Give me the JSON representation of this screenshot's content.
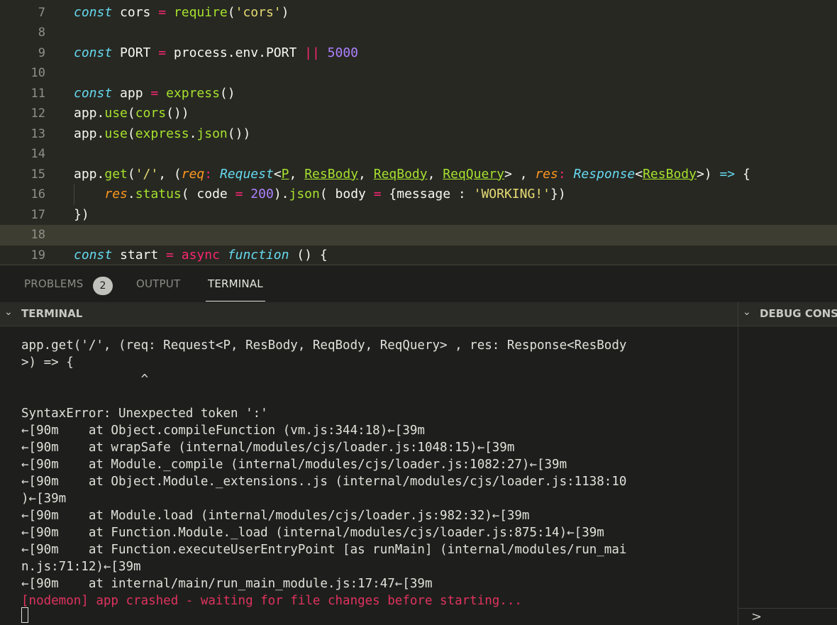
{
  "editor": {
    "lines": [
      {
        "num": "7",
        "tokens": [
          [
            "kw",
            "const"
          ],
          [
            "p",
            " cors "
          ],
          [
            "op",
            "="
          ],
          [
            "p",
            " "
          ],
          [
            "fn",
            "require"
          ],
          [
            "p",
            "("
          ],
          [
            "str",
            "'cors'"
          ],
          [
            "p",
            ")"
          ]
        ]
      },
      {
        "num": "8",
        "tokens": []
      },
      {
        "num": "9",
        "tokens": [
          [
            "kw",
            "const"
          ],
          [
            "p",
            " PORT "
          ],
          [
            "op",
            "="
          ],
          [
            "p",
            " process.env.PORT "
          ],
          [
            "op",
            "||"
          ],
          [
            "p",
            " "
          ],
          [
            "num",
            "5000"
          ]
        ]
      },
      {
        "num": "10",
        "tokens": []
      },
      {
        "num": "11",
        "tokens": [
          [
            "kw",
            "const"
          ],
          [
            "p",
            " app "
          ],
          [
            "op",
            "="
          ],
          [
            "p",
            " "
          ],
          [
            "fn",
            "express"
          ],
          [
            "p",
            "()"
          ]
        ]
      },
      {
        "num": "12",
        "tokens": [
          [
            "p",
            "app."
          ],
          [
            "fn",
            "use"
          ],
          [
            "p",
            "("
          ],
          [
            "fn",
            "cors"
          ],
          [
            "p",
            "())"
          ]
        ]
      },
      {
        "num": "13",
        "tokens": [
          [
            "p",
            "app."
          ],
          [
            "fn",
            "use"
          ],
          [
            "p",
            "("
          ],
          [
            "fn",
            "express"
          ],
          [
            "p",
            "."
          ],
          [
            "fn",
            "json"
          ],
          [
            "p",
            "())"
          ]
        ]
      },
      {
        "num": "14",
        "tokens": []
      },
      {
        "num": "15",
        "tokens": [
          [
            "p",
            "app."
          ],
          [
            "fn",
            "get"
          ],
          [
            "p",
            "("
          ],
          [
            "str",
            "'/'"
          ],
          [
            "p",
            ", ("
          ],
          [
            "param",
            "req"
          ],
          [
            "op",
            ":"
          ],
          [
            "p",
            " "
          ],
          [
            "type",
            "Request"
          ],
          [
            "p",
            "<"
          ],
          [
            "ul",
            "P"
          ],
          [
            "p",
            ", "
          ],
          [
            "ul",
            "ResBody"
          ],
          [
            "p",
            ", "
          ],
          [
            "ul",
            "ReqBody"
          ],
          [
            "p",
            ", "
          ],
          [
            "ul",
            "ReqQuery"
          ],
          [
            "p",
            "> , "
          ],
          [
            "param",
            "res"
          ],
          [
            "op",
            ":"
          ],
          [
            "p",
            " "
          ],
          [
            "type",
            "Response"
          ],
          [
            "p",
            "<"
          ],
          [
            "ul",
            "ResBody"
          ],
          [
            "p",
            ">) "
          ],
          [
            "kw",
            "=>"
          ],
          [
            "p",
            " {"
          ]
        ]
      },
      {
        "num": "16",
        "tokens": [
          [
            "p",
            "    "
          ],
          [
            "param",
            "res"
          ],
          [
            "p",
            "."
          ],
          [
            "fn",
            "status"
          ],
          [
            "p",
            "( code "
          ],
          [
            "op",
            "="
          ],
          [
            "p",
            " "
          ],
          [
            "num",
            "200"
          ],
          [
            "p",
            ")."
          ],
          [
            "fn",
            "json"
          ],
          [
            "p",
            "( body "
          ],
          [
            "op",
            "="
          ],
          [
            "p",
            " {message : "
          ],
          [
            "str",
            "'WORKING!'"
          ],
          [
            "p",
            "})"
          ]
        ],
        "indent_guide": true
      },
      {
        "num": "17",
        "tokens": [
          [
            "p",
            "})"
          ]
        ]
      },
      {
        "num": "18",
        "tokens": [],
        "current": true
      },
      {
        "num": "19",
        "tokens": [
          [
            "kw",
            "const"
          ],
          [
            "p",
            " start "
          ],
          [
            "op",
            "="
          ],
          [
            "p",
            " "
          ],
          [
            "op",
            "async"
          ],
          [
            "p",
            " "
          ],
          [
            "kw",
            "function"
          ],
          [
            "p",
            " () {"
          ]
        ]
      }
    ]
  },
  "panel": {
    "tabs": [
      {
        "label": "PROBLEMS",
        "badge": "2",
        "active": false
      },
      {
        "label": "OUTPUT",
        "active": false
      },
      {
        "label": "TERMINAL",
        "active": true
      }
    ]
  },
  "terminal": {
    "header": "TERMINAL",
    "lines": [
      {
        "text": "app.get('/', (req: Request<P, ResBody, ReqBody, ReqQuery> , res: Response<ResBody"
      },
      {
        "text": ">) => {"
      },
      {
        "text": "                ^"
      },
      {
        "text": ""
      },
      {
        "text": "SyntaxError: Unexpected token ':'"
      },
      {
        "text": "←[90m    at Object.compileFunction (vm.js:344:18)←[39m"
      },
      {
        "text": "←[90m    at wrapSafe (internal/modules/cjs/loader.js:1048:15)←[39m"
      },
      {
        "text": "←[90m    at Module._compile (internal/modules/cjs/loader.js:1082:27)←[39m"
      },
      {
        "text": "←[90m    at Object.Module._extensions..js (internal/modules/cjs/loader.js:1138:10"
      },
      {
        "text": ")←[39m"
      },
      {
        "text": "←[90m    at Module.load (internal/modules/cjs/loader.js:982:32)←[39m"
      },
      {
        "text": "←[90m    at Function.Module._load (internal/modules/cjs/loader.js:875:14)←[39m"
      },
      {
        "text": "←[90m    at Function.executeUserEntryPoint [as runMain] (internal/modules/run_mai"
      },
      {
        "text": "n.js:71:12)←[39m"
      },
      {
        "text": "←[90m    at internal/main/run_main_module.js:17:47←[39m"
      },
      {
        "text": "[nodemon] app crashed - waiting for file changes before starting...",
        "error": true
      }
    ]
  },
  "debug": {
    "header": "DEBUG CONS",
    "prompt": ">"
  },
  "colors": {
    "editor_bg": "#272822",
    "panel_bg": "#1e1f1c",
    "keyword": "#66d9ef",
    "operator": "#f92672",
    "function": "#a6e22e",
    "string": "#e6db74",
    "number": "#ae81ff",
    "parameter": "#fd971f",
    "error_text": "#e0325f"
  }
}
